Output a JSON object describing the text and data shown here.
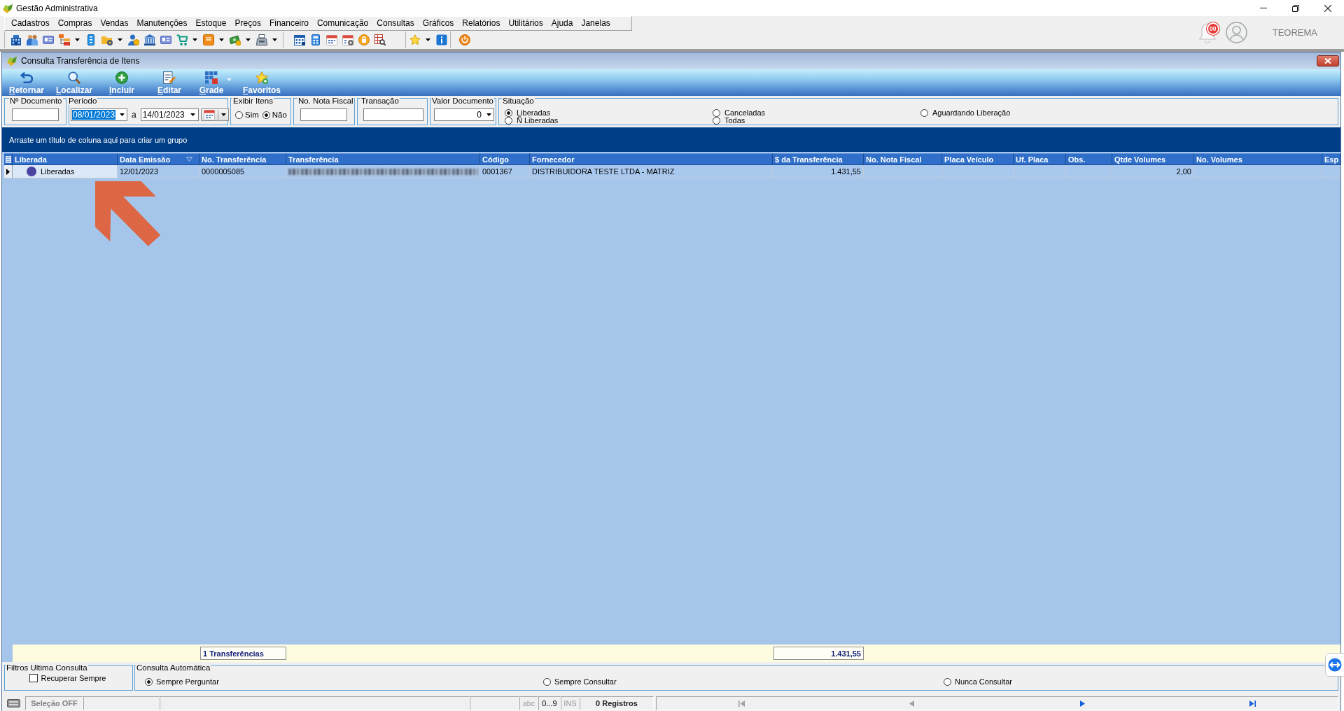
{
  "window": {
    "title": "Gestão Administrativa"
  },
  "menu": [
    "Cadastros",
    "Compras",
    "Vendas",
    "Manutenções",
    "Estoque",
    "Preços",
    "Financeiro",
    "Comunicação",
    "Consultas",
    "Gráficos",
    "Relatórios",
    "Utilitários",
    "Ajuda",
    "Janelas"
  ],
  "header": {
    "notification_count": "00",
    "user_name": "TEOREMA"
  },
  "child_window": {
    "title": "Consulta Transferência de Itens"
  },
  "toolbar": [
    {
      "label": "Retornar",
      "dropdown": false
    },
    {
      "label": "Localizar",
      "dropdown": false
    },
    {
      "label": "Incluir",
      "dropdown": false
    },
    {
      "label": "Editar",
      "dropdown": false
    },
    {
      "label": "Grade",
      "dropdown": true
    },
    {
      "label": "Favoritos",
      "dropdown": false
    }
  ],
  "filters": {
    "document_number": {
      "label": "Nº Documento"
    },
    "period": {
      "label": "Período",
      "from": {
        "value": "08/01/2023",
        "highlighted": true
      },
      "separator": "a",
      "to": {
        "value": "14/01/2023",
        "highlighted": false
      }
    },
    "show_items": {
      "label": "Exibir Itens",
      "options": [
        {
          "label": "Sim",
          "selected": false
        },
        {
          "label": "Não",
          "selected": true
        }
      ]
    },
    "invoice_number": {
      "label": "No. Nota Fiscal"
    },
    "transaction": {
      "label": "Transação"
    },
    "document_value": {
      "label": "Valor Documento",
      "value": "0"
    },
    "status": {
      "label": "Situação",
      "options": [
        {
          "label": "Liberadas",
          "selected": true
        },
        {
          "label": "Canceladas",
          "selected": false
        },
        {
          "label": "Aguardando Liberação",
          "selected": false
        },
        {
          "label": "Ñ Liberadas",
          "selected": false
        },
        {
          "label": "Todas",
          "selected": false
        }
      ]
    }
  },
  "group_panel": {
    "hint": "Arraste um título de coluna aqui para criar um grupo"
  },
  "table": {
    "columns": [
      {
        "label": "Liberada",
        "sorted": false
      },
      {
        "label": "Data Emissão",
        "sorted": true
      },
      {
        "label": "No. Transferência",
        "sorted": false
      },
      {
        "label": "Transferência",
        "sorted": false
      },
      {
        "label": "Código",
        "sorted": false
      },
      {
        "label": "Fornecedor",
        "sorted": false
      },
      {
        "label": "$ da Transferência",
        "sorted": false
      },
      {
        "label": "No. Nota Fiscal",
        "sorted": false
      },
      {
        "label": "Placa Veículo",
        "sorted": false
      },
      {
        "label": "Uf. Placa",
        "sorted": false
      },
      {
        "label": "Obs.",
        "sorted": false
      },
      {
        "label": "Qtde Volumes",
        "sorted": false
      },
      {
        "label": "No. Volumes",
        "sorted": false
      },
      {
        "label": "Esp",
        "sorted": false
      }
    ],
    "rows": [
      {
        "selected": true,
        "status": {
          "label": "Liberadas",
          "color": "#4c43a0"
        },
        "data_emissao": "12/01/2023",
        "no_transferencia": "0000005085",
        "transferencia_redacted": true,
        "codigo": "0001367",
        "fornecedor": "DISTRIBUIDORA TESTE LTDA - MATRIZ",
        "valor_transferencia": "1.431,55",
        "qtde_volumes": "2,00"
      }
    ]
  },
  "summary": {
    "count": "1 Transferências",
    "total": "1.431,55"
  },
  "options": {
    "last_filters": {
      "label": "Filtros Ultima Consulta",
      "checkbox": {
        "label": "Recuperar Sempre",
        "checked": false
      }
    },
    "auto_query": {
      "label": "Consulta Automática",
      "options": [
        {
          "label": "Sempre Perguntar",
          "selected": true
        },
        {
          "label": "Sempre Consultar",
          "selected": false
        },
        {
          "label": "Nunca Consultar",
          "selected": false
        }
      ]
    }
  },
  "status_bar": {
    "selection": "Seleção OFF",
    "indicators": [
      {
        "label": "abc",
        "on": false
      },
      {
        "label": "0...9",
        "on": true
      },
      {
        "label": "INS",
        "on": false
      }
    ],
    "records": "0 Registros",
    "navigation": [
      {
        "kind": "first",
        "disabled": true
      },
      {
        "kind": "previous",
        "disabled": true
      },
      {
        "kind": "next",
        "disabled": false
      },
      {
        "kind": "last",
        "disabled": false
      }
    ]
  }
}
